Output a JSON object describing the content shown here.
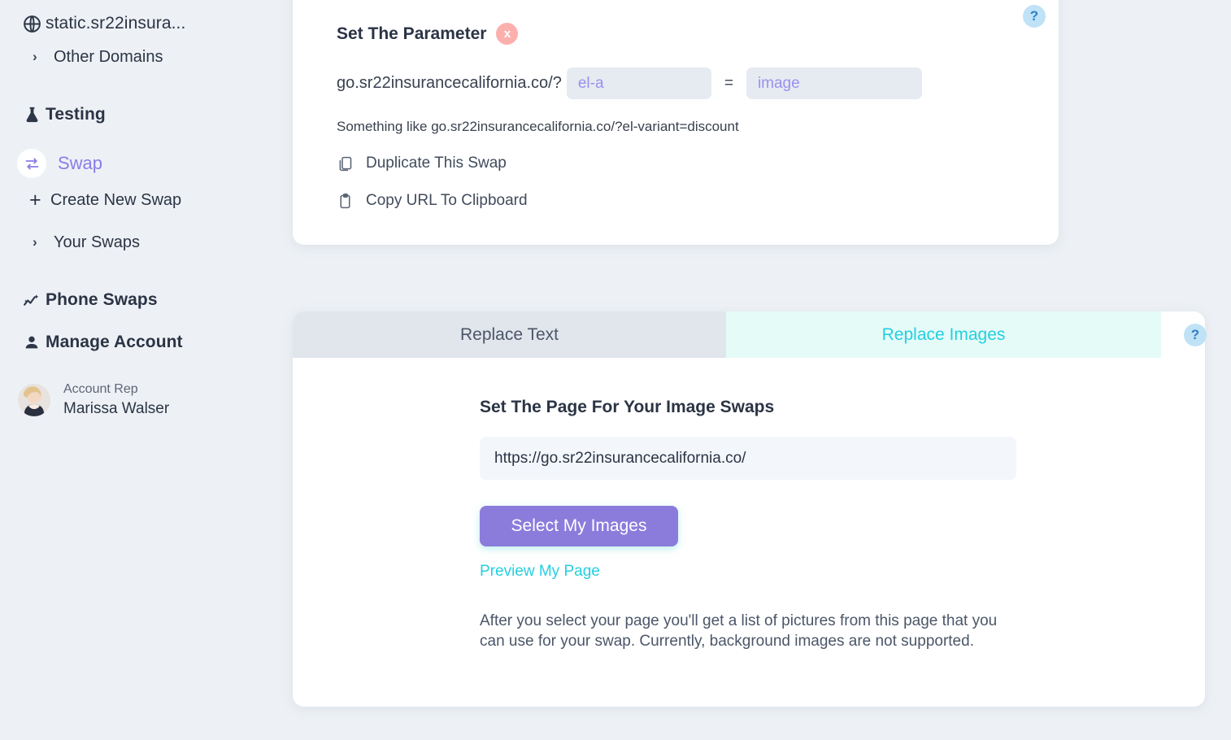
{
  "sidebar": {
    "domain": {
      "icon": "globe-icon",
      "label": "static.sr22insura..."
    },
    "other_domains": {
      "icon": "chevron-right-icon",
      "label": "Other Domains"
    },
    "testing": {
      "icon": "flask-icon",
      "label": "Testing"
    },
    "swap": {
      "icon": "swap-arrows-icon",
      "label": "Swap",
      "active": true,
      "accent": "#8b7ce8"
    },
    "create_new_swap": {
      "icon": "plus-icon",
      "label": "Create New Swap"
    },
    "your_swaps": {
      "icon": "chevron-right-icon",
      "label": "Your Swaps"
    },
    "phone_swaps": {
      "icon": "sparkle-chart-icon",
      "label": "Phone Swaps"
    },
    "manage_account": {
      "icon": "person-icon",
      "label": "Manage Account"
    },
    "account_rep": {
      "role_label": "Account Rep",
      "name": "Marissa Walser",
      "avatar": "avatar-photo"
    }
  },
  "parameter_card": {
    "title": "Set The Parameter",
    "close_badge": "x",
    "url_prefix": "go.sr22insurancecalifornia.co/?",
    "key_placeholder": "el-a",
    "key_value": "",
    "equals": "=",
    "value_placeholder": "image",
    "value_value": "",
    "hint": "Something like go.sr22insurancecalifornia.co/?el-variant=discount",
    "duplicate_swap": {
      "icon": "copy-icon",
      "label": "Duplicate This Swap"
    },
    "copy_url": {
      "icon": "clipboard-icon",
      "label": "Copy URL To Clipboard"
    },
    "help_badge": "?"
  },
  "swap_card": {
    "tabs": [
      {
        "label": "Replace Text",
        "active": false
      },
      {
        "label": "Replace Images",
        "active": true
      }
    ],
    "help_badge": "?",
    "form": {
      "title": "Set The Page For Your Image Swaps",
      "url_value": "https://go.sr22insurancecalifornia.co/",
      "url_placeholder": "https://",
      "select_images_label": "Select My Images",
      "preview_label": "Preview My Page",
      "note": "After you select your page you'll get a list of pictures from this page that you can use for your swap. Currently, background images are not supported."
    }
  },
  "colors": {
    "page_background": "#edf1f5",
    "accent_purple": "#8b7cdc",
    "accent_cyan": "#25cfe0",
    "tab_active_bg": "#e5fbf8",
    "tab_inactive_bg": "#e1e6ed",
    "help_badge_bg": "#bfe2f7",
    "close_badge_bg": "#fcb0ae"
  }
}
